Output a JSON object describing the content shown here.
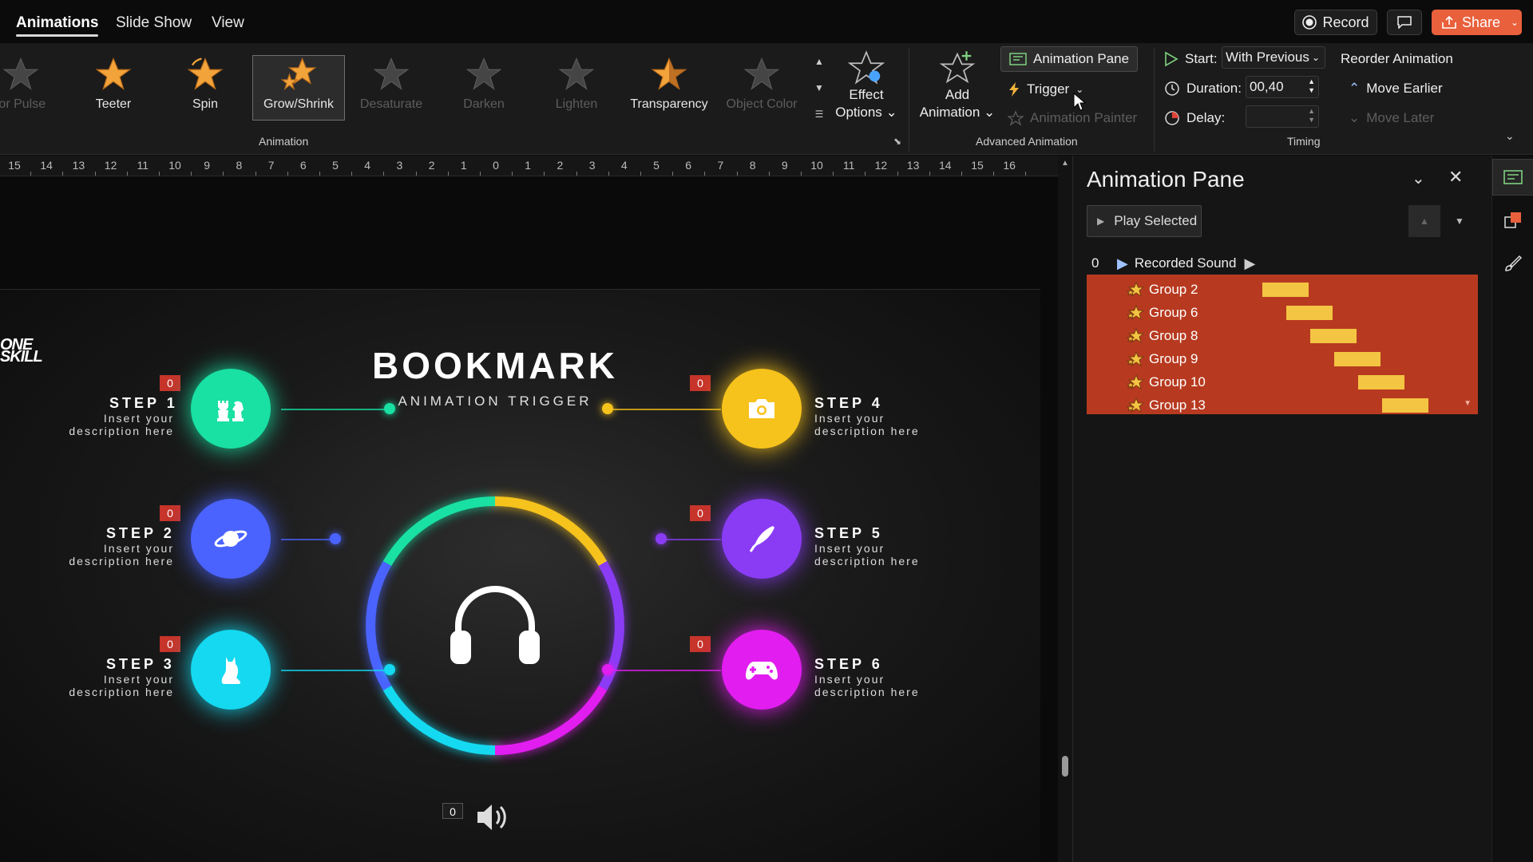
{
  "menu": {
    "tabs": [
      "Animations",
      "Slide Show",
      "View"
    ]
  },
  "top_buttons": {
    "record": "Record",
    "share": "Share"
  },
  "ribbon": {
    "animation_gallery": [
      {
        "label": "lor Pulse",
        "state": "dim"
      },
      {
        "label": "Teeter",
        "state": "normal"
      },
      {
        "label": "Spin",
        "state": "normal"
      },
      {
        "label": "Grow/Shrink",
        "state": "selected"
      },
      {
        "label": "Desaturate",
        "state": "dim"
      },
      {
        "label": "Darken",
        "state": "dim"
      },
      {
        "label": "Lighten",
        "state": "dim"
      },
      {
        "label": "Transparency",
        "state": "normal"
      },
      {
        "label": "Object Color",
        "state": "dim"
      }
    ],
    "animation_group_label": "Animation",
    "effect_options": {
      "line1": "Effect",
      "line2": "Options"
    },
    "add_animation": {
      "line1": "Add",
      "line2": "Animation"
    },
    "animation_pane_btn": "Animation Pane",
    "trigger": "Trigger",
    "animation_painter": "Animation Painter",
    "advanced_group_label": "Advanced Animation",
    "start_label": "Start:",
    "start_value": "With Previous",
    "duration_label": "Duration:",
    "duration_value": "00,40",
    "delay_label": "Delay:",
    "delay_value": "",
    "timing_group_label": "Timing",
    "reorder_title": "Reorder Animation",
    "move_earlier": "Move Earlier",
    "move_later": "Move Later"
  },
  "ruler": {
    "labels": [
      "15",
      "14",
      "13",
      "12",
      "11",
      "10",
      "9",
      "8",
      "7",
      "6",
      "5",
      "4",
      "3",
      "2",
      "1",
      "0",
      "1",
      "2",
      "3",
      "4",
      "5",
      "6",
      "7",
      "8",
      "9",
      "10",
      "11",
      "12",
      "13",
      "14",
      "15",
      "16"
    ]
  },
  "slide": {
    "logo_line1": "ONE",
    "logo_line2": "SKILL",
    "title": "BOOKMARK",
    "subtitle": "ANIMATION TRIGGER",
    "steps": [
      {
        "title": "STEP 1",
        "desc1": "Insert your",
        "desc2": "description here",
        "badge": "0",
        "color": "#19e0a3",
        "icon": "chess-icon"
      },
      {
        "title": "STEP 2",
        "desc1": "Insert your",
        "desc2": "description here",
        "badge": "0",
        "color": "#4a63ff",
        "icon": "planet-icon"
      },
      {
        "title": "STEP 3",
        "desc1": "Insert your",
        "desc2": "description here",
        "badge": "0",
        "color": "#14d9f0",
        "icon": "cat-icon"
      },
      {
        "title": "STEP 4",
        "desc1": "Insert your",
        "desc2": "description here",
        "badge": "0",
        "color": "#f6c21c",
        "icon": "camera-icon"
      },
      {
        "title": "STEP 5",
        "desc1": "Insert your",
        "desc2": "description here",
        "badge": "0",
        "color": "#8a3cf5",
        "icon": "pen-icon"
      },
      {
        "title": "STEP 6",
        "desc1": "Insert your",
        "desc2": "description here",
        "badge": "0",
        "color": "#e21df0",
        "icon": "gamepad-icon"
      }
    ],
    "sound_badge": "0"
  },
  "pane": {
    "title": "Animation Pane",
    "play_selected": "Play Selected",
    "recorded": {
      "index": "0",
      "name": "Recorded Sound"
    },
    "items": [
      {
        "name": "Group 2",
        "start_step": 0
      },
      {
        "name": "Group 6",
        "start_step": 1
      },
      {
        "name": "Group 8",
        "start_step": 2
      },
      {
        "name": "Group 9",
        "start_step": 3
      },
      {
        "name": "Group 10",
        "start_step": 4
      },
      {
        "name": "Group 13",
        "start_step": 5
      }
    ],
    "highlight_color": "#b73a20",
    "bar_color": "#f4c542"
  },
  "colors": {
    "accent": "#e8603c",
    "badge": "#c6342a"
  }
}
